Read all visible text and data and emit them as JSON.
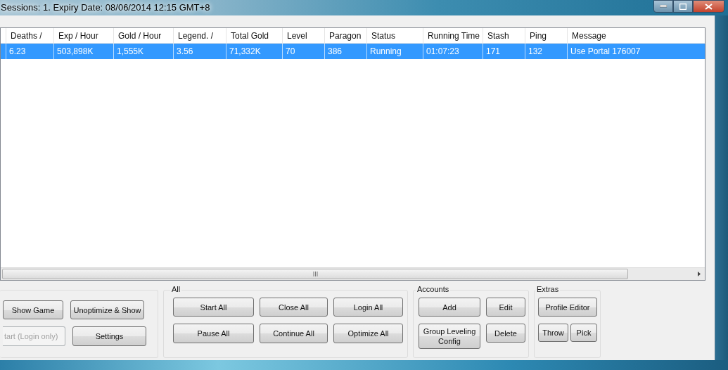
{
  "window": {
    "title": "Sessions: 1. Expiry Date: 08/06/2014 12:15 GMT+8"
  },
  "table": {
    "columns": [
      "",
      "Deaths /",
      "Exp / Hour",
      "Gold / Hour",
      "Legend. /",
      "Total Gold",
      "Level",
      "Paragon",
      "Status",
      "Running Time",
      "Stash",
      "Ping",
      "Message"
    ],
    "rows": [
      {
        "selected": true,
        "cells": [
          "",
          "6.23",
          "503,898K",
          "1,555K",
          "3.56",
          "71,332K",
          "70",
          "386",
          "Running",
          "01:07:23",
          "171",
          "132",
          "Use Portal 176007"
        ]
      }
    ]
  },
  "groups": [
    {
      "rows": [
        [
          {
            "label": "Show Game",
            "disabled": false
          },
          {
            "label": "Unoptimize & Show",
            "disabled": false
          }
        ],
        [
          {
            "label": "tart (Login only)",
            "disabled": true
          },
          {
            "label": "Settings",
            "disabled": false
          }
        ]
      ]
    },
    {
      "title": "All",
      "rows": [
        [
          {
            "label": "Start All",
            "disabled": false
          },
          {
            "label": "Close All",
            "disabled": false
          },
          {
            "label": "Login All",
            "disabled": false
          }
        ],
        [
          {
            "label": "Pause All",
            "disabled": false
          },
          {
            "label": "Continue All",
            "disabled": false
          },
          {
            "label": "Optimize All",
            "disabled": false
          }
        ]
      ]
    },
    {
      "title": "Accounts",
      "rows": [
        [
          {
            "label": "Add",
            "disabled": false
          },
          {
            "label": "Edit",
            "disabled": false
          }
        ],
        [
          {
            "label": "Group Leveling Config",
            "disabled": false
          },
          {
            "label": "Delete",
            "disabled": false
          }
        ]
      ]
    },
    {
      "title": "Extras",
      "rows": [
        [
          {
            "label": "Profile Editor",
            "disabled": false
          }
        ],
        [
          {
            "label": "Throw",
            "disabled": false
          },
          {
            "label": "Pick",
            "disabled": false
          }
        ]
      ]
    }
  ]
}
